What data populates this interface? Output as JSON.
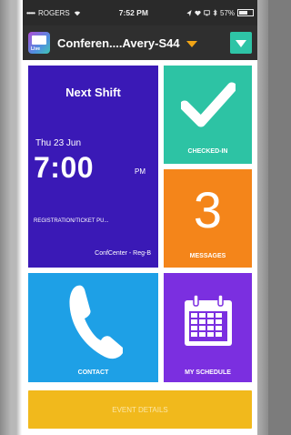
{
  "status_bar": {
    "signal_dots": "•••••",
    "carrier": "ROGERS",
    "wifi_icon": "wifi-icon",
    "time": "7:52 PM",
    "battery": "57%",
    "battery_level": 0.57
  },
  "nav": {
    "logo_text": "Live",
    "title": "Conferen....Avery-S44",
    "caret_color": "#f2a516",
    "menu_color": "#2ec4a6"
  },
  "tiles": {
    "next_shift": {
      "title": "Next Shift",
      "date": "Thu 23 Jun",
      "time": "7:00",
      "ampm": "PM",
      "description": "REGISTRATION/TICKET PU...",
      "location": "ConfCenter - Reg-B",
      "color": "#3a19b6"
    },
    "checked_in": {
      "label": "CHECKED-IN",
      "icon": "checkmark-icon",
      "color": "#2dc3a4"
    },
    "messages": {
      "count": "3",
      "label": "MESSAGES",
      "color": "#f4851a"
    },
    "contact": {
      "label": "CONTACT",
      "icon": "phone-icon",
      "color": "#1ea0e6"
    },
    "schedule": {
      "label": "MY SCHEDULE",
      "icon": "calendar-icon",
      "color": "#7b2fe0"
    },
    "event_details": {
      "label": "EVENT DETAILS",
      "color": "#f1b91c"
    }
  }
}
